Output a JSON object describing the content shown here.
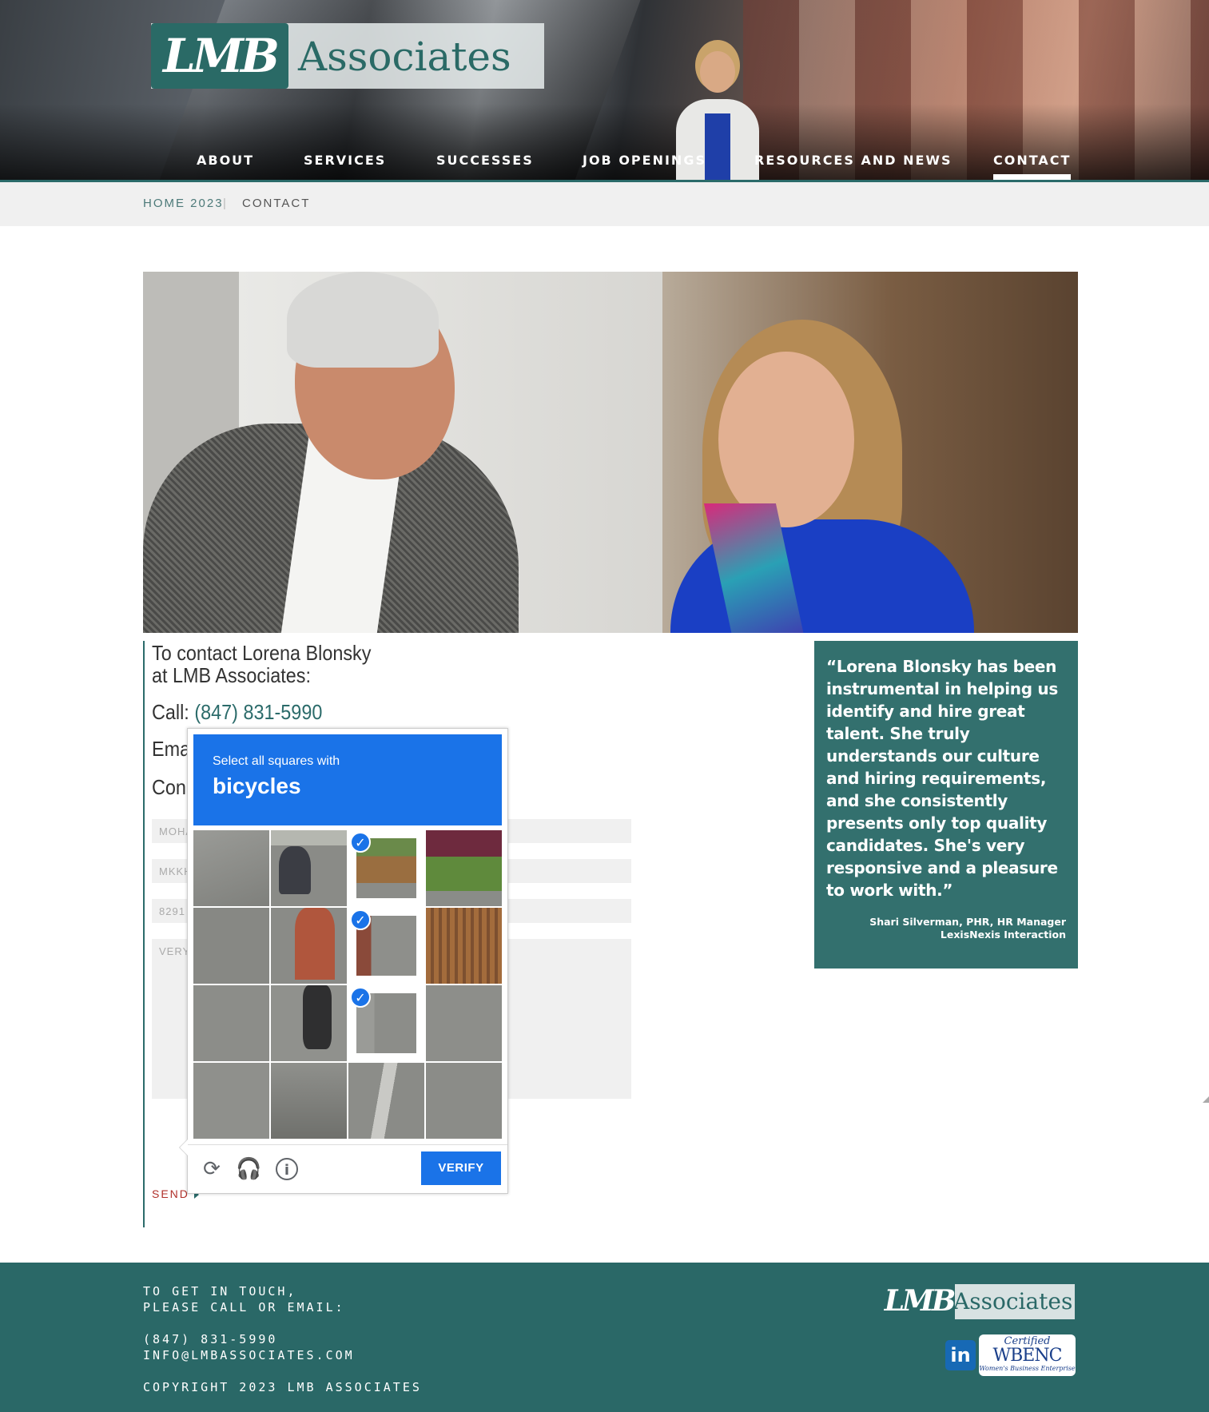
{
  "brand": {
    "logo_mark": "LMB",
    "logo_word": "Associates"
  },
  "nav": {
    "items": [
      {
        "label": "ABOUT"
      },
      {
        "label": "SERVICES"
      },
      {
        "label": "SUCCESSES"
      },
      {
        "label": "JOB OPENINGS"
      },
      {
        "label": "RESOURCES AND NEWS"
      },
      {
        "label": "CONTACT",
        "active": true
      }
    ]
  },
  "breadcrumb": {
    "home": "HOME 2023",
    "separator": "|",
    "current": "CONTACT"
  },
  "contact": {
    "heading_line1": "To contact Lorena Blonsky",
    "heading_line2": "at LMB Associates:",
    "call_label": "Call:",
    "phone": "(847) 831-5990",
    "email_partial": "Ema",
    "connect_partial": "Conn"
  },
  "form": {
    "field1_value": "MOHA",
    "field2_value": "MKKH",
    "field3_value": "8291",
    "message_placeholder": "VERY",
    "send_label": "SEND"
  },
  "captcha": {
    "instruction": "Select all squares with",
    "target": "bicycles",
    "verify_label": "VERIFY",
    "icons": [
      "reload-icon",
      "headphones-icon",
      "info-icon"
    ],
    "selected_tiles": [
      2,
      6,
      10
    ]
  },
  "testimonial": {
    "quote": "“Lorena Blonsky has been instrumental in helping us identify and hire great talent. She truly understands our culture and hiring requirements, and she consistently presents only top quality candidates. She's very responsive and a pleasure to work with.”",
    "author_line1": "Shari Silverman, PHR, HR Manager",
    "author_line2": "LexisNexis Interaction"
  },
  "footer": {
    "line1": "TO GET IN TOUCH,",
    "line2": "PLEASE CALL OR EMAIL:",
    "phone": "(847) 831-5990",
    "email": "INFO@LMBASSOCIATES.COM",
    "copyright": "COPYRIGHT 2023 LMB ASSOCIATES",
    "wbenc_certified": "Certified",
    "wbenc_mark": "WBENC",
    "wbenc_sub": "Women's Business Enterprise",
    "linkedin_text": "in"
  },
  "colors": {
    "brand_teal": "#2a6867",
    "captcha_blue": "#1a73e8",
    "send_red": "#b0302a"
  }
}
